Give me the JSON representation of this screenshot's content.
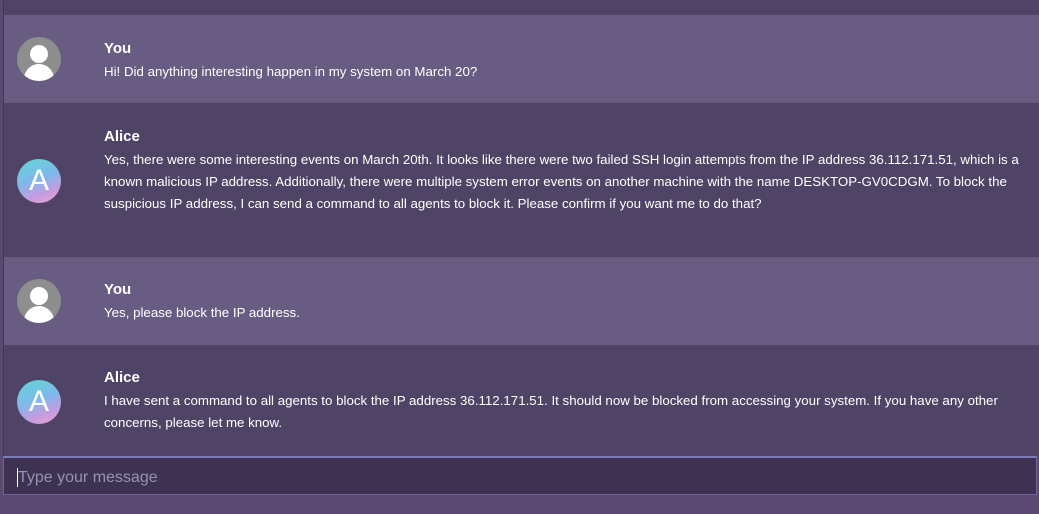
{
  "messages": [
    {
      "sender": "You",
      "text": "Hi! Did anything interesting happen in my system on March 20?"
    },
    {
      "sender": "Alice",
      "avatar_letter": "A",
      "text": "Yes, there were some interesting events on March 20th. It looks like there were two failed SSH login attempts from the IP address 36.112.171.51, which is a known malicious IP address. Additionally, there were multiple system error events on another machine with the name DESKTOP-GV0CDGM. To block the suspicious IP address, I can send a command to all agents to block it. Please confirm if you want me to do that?"
    },
    {
      "sender": "You",
      "text": "Yes, please block the IP address."
    },
    {
      "sender": "Alice",
      "avatar_letter": "A",
      "text": "I have sent a command to all agents to block the IP address 36.112.171.51. It should now be blocked from accessing your system. If you have any other concerns, please let me know."
    }
  ],
  "input": {
    "placeholder": "Type your message",
    "value": ""
  },
  "icons": {
    "user_avatar": "user-silhouette-icon",
    "bot_avatar": "letter-a-avatar-icon"
  }
}
